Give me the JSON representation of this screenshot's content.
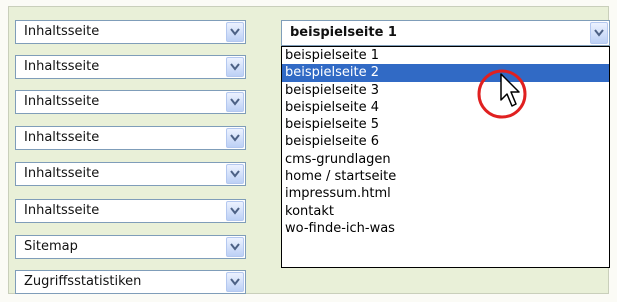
{
  "left_selects": [
    {
      "value": "Inhaltsseite"
    },
    {
      "value": "Inhaltsseite"
    },
    {
      "value": "Inhaltsseite"
    },
    {
      "value": "Inhaltsseite"
    },
    {
      "value": "Inhaltsseite"
    },
    {
      "value": "Inhaltsseite"
    },
    {
      "value": "Sitemap"
    },
    {
      "value": "Zugriffsstatistiken"
    }
  ],
  "page_select": {
    "value": "beispielseite 1",
    "options": [
      "beispielseite 1",
      "beispielseite 2",
      "beispielseite 3",
      "beispielseite 4",
      "beispielseite 5",
      "beispielseite 6",
      "cms-grundlagen",
      "home / startseite",
      "impressum.html",
      "kontakt",
      "wo-finde-ich-was"
    ],
    "highlighted_option": "beispielseite 2"
  },
  "icons": {
    "dropdown_arrow": "chevron-down-icon",
    "cursor": "pointer-cursor-icon",
    "highlight": "red-circle-highlight"
  },
  "colors": {
    "panel_bg": "#e9f0d8",
    "select_border": "#7f9db9",
    "option_highlight": "#316ac5",
    "callout_circle": "#e02020"
  }
}
